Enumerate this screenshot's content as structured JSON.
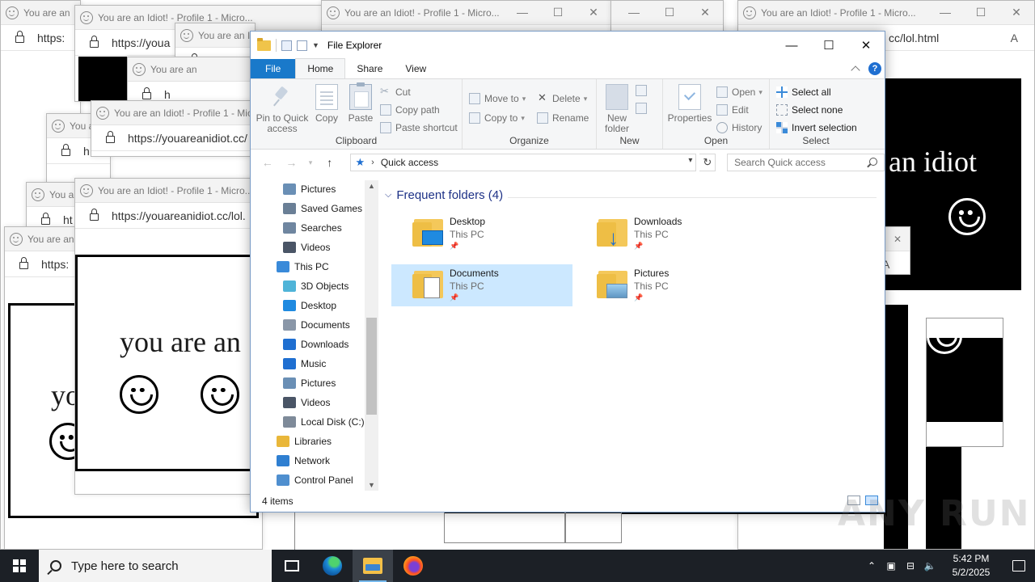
{
  "popups": {
    "title_short": "You are an",
    "title_full": "You are an Idiot! - Profile 1 - Micro...",
    "title_mic": "You are an Idiot! - Profile 1 - Mic",
    "title_n": "You are an Idiot! - Profile 1 - N",
    "title_wide": "You are an Idiot! - Profile 1 - Micro...",
    "title_right": "You are an Idiot! - Profile 1 - Micro...",
    "title_mid": "You are an Idiot! - Profile 1 - Micro...",
    "url_short": "https:",
    "url_a": "https://youa",
    "url_mid": "https://",
    "url_b": "https://youareanidiot.cc/",
    "url_c": "https://youareanidiot.cc/lol.",
    "url_right": "cc/lol.html",
    "letter_h": "h",
    "letter_ht": "ht",
    "text_idiot_a": "you are an",
    "text_idiot_b": "yo",
    "text_idiot_right": "an idiot"
  },
  "explorer": {
    "title": "File Explorer",
    "tabs": [
      "File",
      "Home",
      "Share",
      "View"
    ],
    "clipboard": {
      "pin": "Pin to Quick access",
      "copy": "Copy",
      "paste": "Paste",
      "cut": "Cut",
      "copy_path": "Copy path",
      "paste_shortcut": "Paste shortcut",
      "label": "Clipboard"
    },
    "organize": {
      "move_to": "Move to",
      "copy_to": "Copy to",
      "delete": "Delete",
      "rename": "Rename",
      "label": "Organize"
    },
    "new": {
      "new_folder": "New folder",
      "label": "New"
    },
    "open": {
      "properties": "Properties",
      "open": "Open",
      "edit": "Edit",
      "history": "History",
      "label": "Open"
    },
    "select": {
      "select_all": "Select all",
      "select_none": "Select none",
      "invert": "Invert selection",
      "label": "Select"
    },
    "address": "Quick access",
    "search_placeholder": "Search Quick access",
    "nav_items": [
      "Pictures",
      "Saved Games",
      "Searches",
      "Videos",
      "This PC",
      "3D Objects",
      "Desktop",
      "Documents",
      "Downloads",
      "Music",
      "Pictures",
      "Videos",
      "Local Disk (C:)",
      "Libraries",
      "Network",
      "Control Panel"
    ],
    "section": "Frequent folders (4)",
    "folders": [
      {
        "name": "Desktop",
        "location": "This PC"
      },
      {
        "name": "Downloads",
        "location": "This PC"
      },
      {
        "name": "Documents",
        "location": "This PC"
      },
      {
        "name": "Pictures",
        "location": "This PC"
      }
    ],
    "status": "4 items"
  },
  "taskbar": {
    "search_placeholder": "Type here to search",
    "time": "5:42 PM",
    "date": "5/2/2025"
  },
  "watermark": "ANY RUN",
  "colors": {
    "accent": "#1979ca",
    "selection": "#cce8ff",
    "section_header": "#1e3287",
    "taskbar": "#1c2026"
  }
}
